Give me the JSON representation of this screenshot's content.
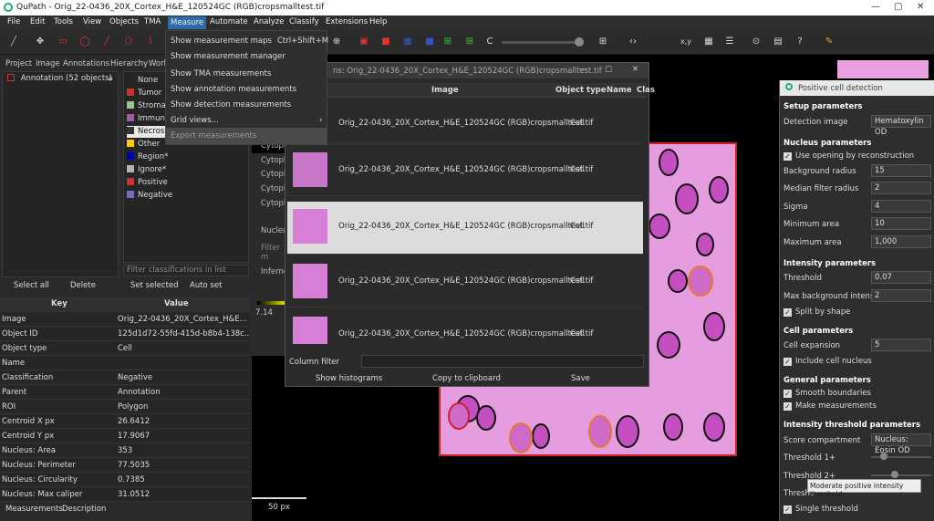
{
  "window": {
    "title": "QuPath - Orig_22-0436_20X_Cortex_H&E_120524GC (RGB)cropsmalltest.tif"
  },
  "menubar": [
    "File",
    "Edit",
    "Tools",
    "View",
    "Objects",
    "TMA",
    "Measure",
    "Automate",
    "Analyze",
    "Classify",
    "Extensions",
    "Help"
  ],
  "measure_menu": {
    "items": [
      {
        "label": "Show measurement maps",
        "shortcut": "Ctrl+Shift+M"
      },
      {
        "label": "Show measurement manager",
        "shortcut": ""
      },
      {
        "label": "Show TMA measurements",
        "shortcut": ""
      },
      {
        "label": "Show annotation measurements",
        "shortcut": ""
      },
      {
        "label": "Show detection measurements",
        "shortcut": ""
      },
      {
        "label": "Grid views...",
        "shortcut": ""
      },
      {
        "label": "Export measurements",
        "shortcut": ""
      }
    ]
  },
  "left_tabs": [
    "Project",
    "Image",
    "Annotations",
    "Hierarchy",
    "Work"
  ],
  "annotation_item": "Annotation (52 objects)",
  "classes": [
    {
      "name": "None",
      "color": ""
    },
    {
      "name": "Tumor",
      "color": "#c83232"
    },
    {
      "name": "Stroma",
      "color": "#96c896"
    },
    {
      "name": "Immune c",
      "color": "#a05aa0"
    },
    {
      "name": "Necrosis",
      "color": "#323232"
    },
    {
      "name": "Other",
      "color": "#ffc800"
    },
    {
      "name": "Region*",
      "color": "#0000b4"
    },
    {
      "name": "Ignore*",
      "color": "#b4b4b4"
    },
    {
      "name": "Positive",
      "color": "#c83232"
    },
    {
      "name": "Negative",
      "color": "#7070c0"
    }
  ],
  "left_buttons": {
    "select_all": "Select all",
    "delete": "Delete",
    "set_selected": "Set selected",
    "auto_set": "Auto set",
    "filter_placeholder": "Filter classifications in list"
  },
  "props": {
    "key_header": "Key",
    "value_header": "Value",
    "rows": [
      {
        "k": "Image",
        "v": "Orig_22-0436_20X_Cortex_H&E..."
      },
      {
        "k": "Object ID",
        "v": "125d1d72-55fd-415d-b8b4-138c..."
      },
      {
        "k": "Object type",
        "v": "Cell"
      },
      {
        "k": "Name",
        "v": ""
      },
      {
        "k": "Classification",
        "v": "Negative"
      },
      {
        "k": "Parent",
        "v": "Annotation"
      },
      {
        "k": "ROI",
        "v": "Polygon"
      },
      {
        "k": "Centroid X px",
        "v": "26.6412"
      },
      {
        "k": "Centroid Y px",
        "v": "17.9067"
      },
      {
        "k": "Nucleus: Area",
        "v": "353"
      },
      {
        "k": "Nucleus: Perimeter",
        "v": "77.5035"
      },
      {
        "k": "Nucleus: Circularity",
        "v": "0.7385"
      },
      {
        "k": "Nucleus: Max caliper",
        "v": "31.0512"
      }
    ]
  },
  "bottom_tabs": [
    "Measurements",
    "Description"
  ],
  "measure_window": {
    "title": "ns: Orig_22-0436_20X_Cortex_H&E_120524GC (RGB)cropsmalltest.tif",
    "columns": [
      "Image",
      "Object type",
      "Name",
      "Clas"
    ],
    "rows": [
      {
        "image": "Orig_22-0436_20X_Cortex_H&E_120524GC (RGB)cropsmalltest.tif",
        "type": "Cell"
      },
      {
        "image": "Orig_22-0436_20X_Cortex_H&E_120524GC (RGB)cropsmalltest.tif",
        "type": "Cell"
      },
      {
        "image": "Orig_22-0436_20X_Cortex_H&E_120524GC (RGB)cropsmalltest.tif",
        "type": "Cell"
      },
      {
        "image": "Orig_22-0436_20X_Cortex_H&E_120524GC (RGB)cropsmalltest.tif",
        "type": "Cell"
      },
      {
        "image": "Orig_22-0436_20X_Cortex_H&E_120524GC (RGB)cropsmalltest.tif",
        "type": "Cell"
      }
    ],
    "column_filter": "Column filter",
    "show_histograms": "Show histograms",
    "copy": "Copy to clipboard",
    "save": "Save"
  },
  "behind_panel": {
    "items": [
      "Cytopla",
      "Cytopla",
      "Cytopla",
      "Cytopla",
      "Cytopla",
      "Nucleu"
    ],
    "filter": "Filter m",
    "dropdown": "Inferno",
    "value": "7.14"
  },
  "scalebar": "50 px",
  "pcd": {
    "title": "Positive cell detection",
    "setup": "Setup parameters",
    "detection_image_label": "Detection image",
    "detection_image_value": "Hematoxylin OD",
    "nucleus_params": "Nucleus parameters",
    "use_opening": "Use opening by reconstruction",
    "background_radius_label": "Background radius",
    "background_radius": "15",
    "median_label": "Median filter radius",
    "median": "2",
    "sigma_label": "Sigma",
    "sigma": "4",
    "min_area_label": "Minimum area",
    "min_area": "10",
    "max_area_label": "Maximum area",
    "max_area": "1,000",
    "intensity_params": "Intensity parameters",
    "threshold_label": "Threshold",
    "threshold": "0.07",
    "max_bg_label": "Max background intensity",
    "max_bg": "2",
    "split": "Split by shape",
    "cell_params": "Cell parameters",
    "cell_exp_label": "Cell expansion",
    "cell_exp": "5",
    "include_nucleus": "Include cell nucleus",
    "general_params": "General parameters",
    "smooth": "Smooth boundaries",
    "make_meas": "Make measurements",
    "ithresh_params": "Intensity threshold parameters",
    "score_label": "Score compartment",
    "score": "Nucleus: Eosin OD",
    "t1": "Threshold 1+",
    "t2": "Threshold 2+",
    "t3": "Thresho",
    "single": "Single threshold",
    "tooltip": "Moderate positive intensity threshold"
  }
}
